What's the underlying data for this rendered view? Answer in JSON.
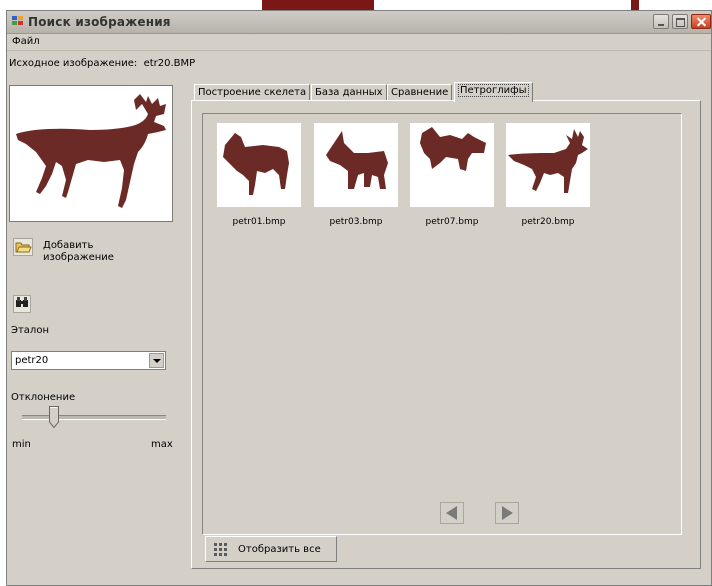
{
  "window": {
    "title": "Поиск изображения"
  },
  "menu": {
    "file": "Файл"
  },
  "source_image": {
    "label": "Исходное изображение:",
    "filename": "etr20.BMP"
  },
  "left_panel": {
    "add_image_label": "Добавить изображение",
    "standard_label": "Эталон",
    "standard_selected": "petr20",
    "deviation_label": "Отклонение",
    "deviation_fraction": 0.2,
    "slider_min": "min",
    "slider_max": "max"
  },
  "tabs": [
    {
      "label": "Построение скелета",
      "active": false
    },
    {
      "label": "База данных",
      "active": false
    },
    {
      "label": "Сравнение",
      "active": false
    },
    {
      "label": "Петроглифы",
      "active": true
    }
  ],
  "gallery": {
    "items": [
      {
        "name": "petr01.bmp"
      },
      {
        "name": "petr03.bmp"
      },
      {
        "name": "petr07.bmp"
      },
      {
        "name": "petr20.bmp"
      }
    ]
  },
  "show_all_label": "Отобразить все",
  "colors": {
    "figure": "#6b2a26",
    "accent": "#7a1717"
  },
  "icons": {
    "open": "folder-open-icon",
    "search": "binoculars-icon",
    "show_all": "grid-icon"
  }
}
